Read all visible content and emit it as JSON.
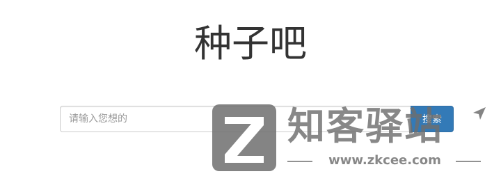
{
  "page": {
    "title": "种子吧"
  },
  "search": {
    "placeholder": "请输入您想的",
    "value": "",
    "button_label": "搜索"
  },
  "watermark": {
    "text": "知客驿站",
    "url": "www.zkcee.com",
    "color": "#6e6e6e"
  },
  "colors": {
    "primary": "#337ab7",
    "title": "#333333",
    "border": "#cccccc"
  }
}
